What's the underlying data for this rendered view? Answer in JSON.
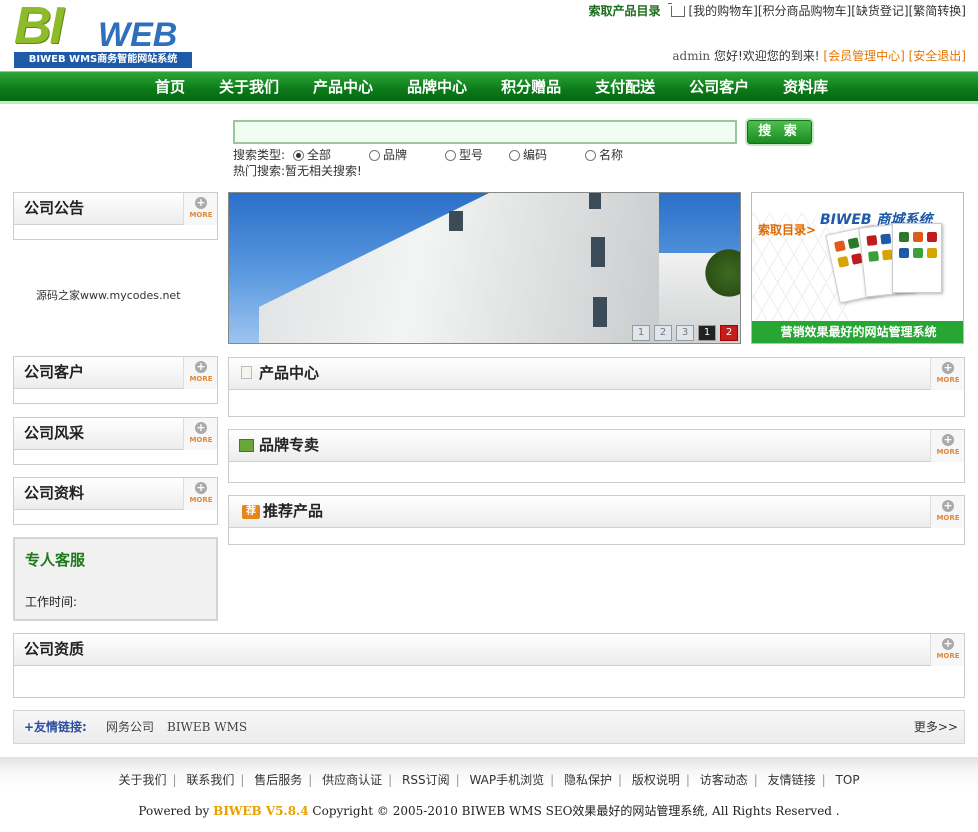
{
  "header": {
    "logo_main": "BI",
    "logo_sub": "WEB",
    "logo_tagline": "BIWEB WMS商务智能网站系统",
    "catalog_link": "索取产品目录",
    "top_links": [
      "[我的购物车]",
      "[积分商品购物车]",
      "[缺货登记]",
      "[繁简转换]"
    ],
    "username": "admin",
    "welcome_text": "您好!欢迎您的到来!",
    "member_center": "[会员管理中心]",
    "logout": "[安全退出]"
  },
  "nav": {
    "items": [
      "首页",
      "关于我们",
      "产品中心",
      "品牌中心",
      "积分赠品",
      "支付配送",
      "公司客户",
      "资料库"
    ]
  },
  "search": {
    "button_label": "搜 索",
    "type_label": "搜索类型:",
    "options": [
      "全部",
      "品牌",
      "型号",
      "编码",
      "名称"
    ],
    "selected": "全部",
    "hot_label": "热门搜索:",
    "hot_value": "暂无相关搜索!"
  },
  "left": {
    "announcement_title": "公司公告",
    "announcement_text": "源码之家www.mycodes.net",
    "customers_title": "公司客户",
    "style_title": "公司风采",
    "docs_title": "公司资料",
    "service_title": "专人客服",
    "service_hours": "工作时间:"
  },
  "banner": {
    "pages": [
      "1",
      "2",
      "3",
      "1",
      "2"
    ]
  },
  "ad": {
    "catalog_text": "索取目录>",
    "brand_text": "BIWEB 商城系统",
    "slogan": "营销效果最好的网站管理系统"
  },
  "sections": {
    "products": "产品中心",
    "brands": "品牌专卖",
    "recommended": "推荐产品",
    "qualification": "公司资质"
  },
  "more_label": "MORE",
  "friend_links": {
    "label": "+友情链接:",
    "items": [
      "网务公司",
      "BIWEB WMS"
    ],
    "more": "更多>>"
  },
  "footer": {
    "links": [
      "关于我们",
      "联系我们",
      "售后服务",
      "供应商认证",
      "RSS订阅",
      "WAP手机浏览",
      "隐私保护",
      "版权说明",
      "访客动态",
      "友情链接",
      "TOP"
    ],
    "powered_by": "Powered by",
    "brand": "BIWEB V5.8.4",
    "copyright": "Copyright © 2005-2010 BIWEB WMS SEO效果最好的网站管理系统, All Rights Reserved ."
  },
  "colors": {
    "nav_green": "#0c7a18",
    "accent_orange": "#e67600",
    "link_blue": "#2b4fa0"
  }
}
